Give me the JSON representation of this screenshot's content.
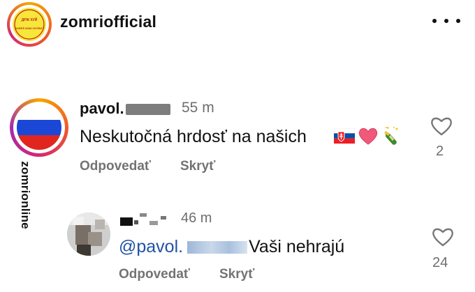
{
  "header": {
    "username": "zomriofficial",
    "avatar_icon": "zomri-logo-icon",
    "avatar_text_top": "ДРЖ ХУЙ",
    "avatar_text_bottom": "BUDEŠ NÁM CHÝBAŤ",
    "more_icon": "more-horizontal-icon"
  },
  "comments": [
    {
      "username": "pavol.",
      "time": "55 m",
      "text": "Neskutočná hrdosť na našich",
      "emojis": [
        "slovakia-flag-emoji",
        "pink-heart-emoji",
        "champagne-emoji"
      ],
      "reply_label": "Odpovedať",
      "hide_label": "Skryť",
      "like_count": "2",
      "like_icon": "heart-outline-icon",
      "avatar_icon": "russia-flag-icon",
      "flag_colors": [
        "#ffffff",
        "#1b47d6",
        "#e0261f"
      ]
    }
  ],
  "reply": {
    "time": "46 m",
    "mention": "@pavol.",
    "text": "Vaši nehrajú",
    "reply_label": "Odpovedať",
    "hide_label": "Skryť",
    "like_count": "24",
    "like_icon": "heart-outline-icon",
    "avatar_icon": "blurred-avatar-icon"
  },
  "watermark": {
    "text": "zomrionline"
  },
  "colors": {
    "mention": "#1f53a3",
    "secondary_text": "#737373",
    "story_ring_start": "#f7a500",
    "story_ring_end": "#d5286f"
  }
}
